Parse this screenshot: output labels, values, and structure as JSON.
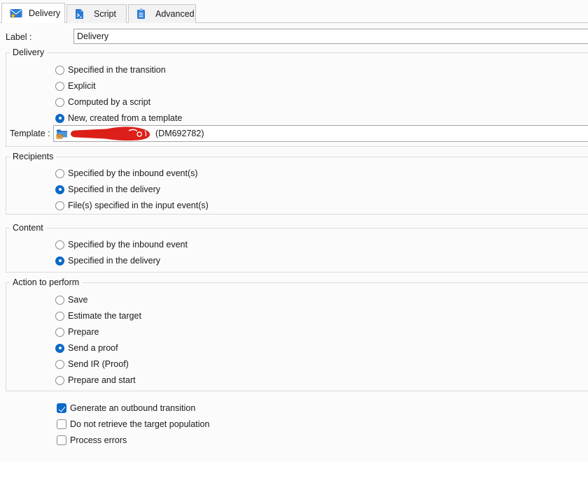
{
  "tabs": [
    {
      "label": "Delivery",
      "icon": "mail-star-icon",
      "active": true
    },
    {
      "label": "Script",
      "icon": "script-icon",
      "active": false
    },
    {
      "label": "Advanced",
      "icon": "clipboard-icon",
      "active": false
    }
  ],
  "label_field": {
    "label": "Label :",
    "value": "Delivery"
  },
  "groups": {
    "delivery": {
      "title": "Delivery",
      "options": [
        {
          "label": "Specified in the transition",
          "selected": false
        },
        {
          "label": "Explicit",
          "selected": false
        },
        {
          "label": "Computed by a script",
          "selected": false
        },
        {
          "label": "New, created from a template",
          "selected": true
        }
      ],
      "template_field": {
        "label": "Template :",
        "redacted": true,
        "visible_suffix": "(DM692782)"
      }
    },
    "recipients": {
      "title": "Recipients",
      "options": [
        {
          "label": "Specified by the inbound event(s)",
          "selected": false
        },
        {
          "label": "Specified in the delivery",
          "selected": true
        },
        {
          "label": "File(s) specified in the input event(s)",
          "selected": false
        }
      ]
    },
    "content": {
      "title": "Content",
      "options": [
        {
          "label": "Specified by the inbound event",
          "selected": false
        },
        {
          "label": "Specified in the delivery",
          "selected": true
        }
      ]
    },
    "action": {
      "title": "Action to perform",
      "options": [
        {
          "label": "Save",
          "selected": false
        },
        {
          "label": "Estimate the target",
          "selected": false
        },
        {
          "label": "Prepare",
          "selected": false
        },
        {
          "label": "Send a proof",
          "selected": true
        },
        {
          "label": "Send IR (Proof)",
          "selected": false
        },
        {
          "label": "Prepare and start",
          "selected": false
        }
      ]
    }
  },
  "checkboxes": {
    "items": [
      {
        "label": "Generate an outbound transition",
        "checked": true
      },
      {
        "label": "Do not retrieve the target population",
        "checked": false
      },
      {
        "label": "Process errors",
        "checked": false
      }
    ]
  },
  "colors": {
    "accent": "#0b69c7",
    "icon_blue": "#2b7cd3",
    "redaction_red": "#dd1f1a",
    "star_gold": "#f5b922",
    "envelope_orange": "#e8a23c"
  }
}
